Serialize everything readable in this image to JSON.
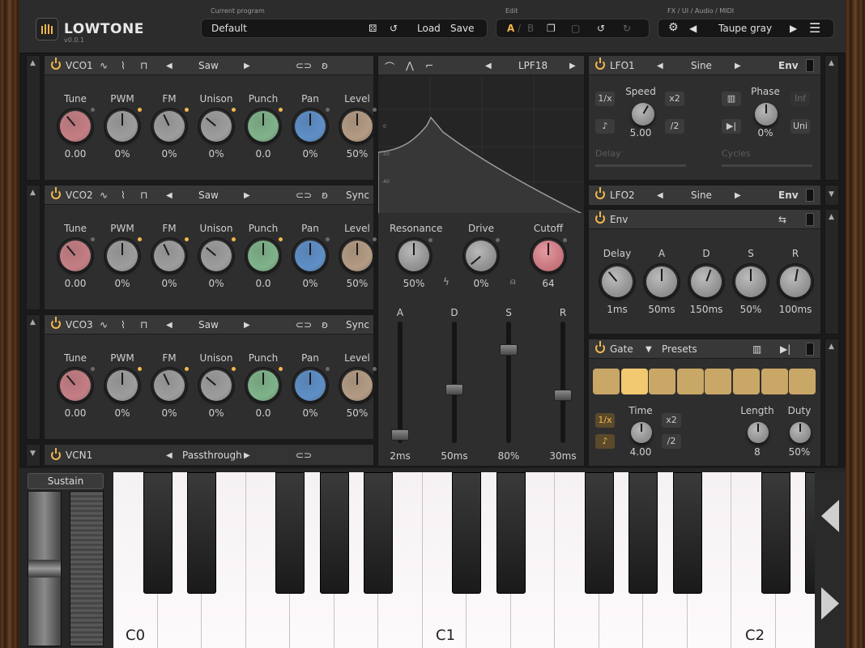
{
  "app": {
    "title": "LOWTONE",
    "version": "v0.0.1"
  },
  "topbar": {
    "program_label": "Current program",
    "program_name": "Default",
    "load": "Load",
    "save": "Save",
    "edit_label": "Edit",
    "edit_a": "A",
    "edit_sep": "/",
    "edit_b": "B",
    "fx_label": "FX / UI / Audio / MIDI",
    "theme": "Taupe gray"
  },
  "vco_common": {
    "labels": [
      "Tune",
      "PWM",
      "FM",
      "Unison",
      "Punch",
      "Pan",
      "Level"
    ],
    "colors": [
      "#c47e84",
      "#9d9d9d",
      "#9d9d9d",
      "#9d9d9d",
      "#7fb38a",
      "#5e8fc7",
      "#b39b84"
    ]
  },
  "vco1": {
    "name": "VCO1",
    "wave": "Saw",
    "sync": "",
    "values": [
      "0.00",
      "0%",
      "0%",
      "0%",
      "0.0",
      "0%",
      "50%"
    ]
  },
  "vco2": {
    "name": "VCO2",
    "wave": "Saw",
    "sync": "Sync",
    "values": [
      "0.00",
      "0%",
      "0%",
      "0%",
      "0.0",
      "0%",
      "50%"
    ]
  },
  "vco3": {
    "name": "VCO3",
    "wave": "Saw",
    "sync": "Sync",
    "values": [
      "0.00",
      "0%",
      "0%",
      "0%",
      "0.0",
      "0%",
      "50%"
    ]
  },
  "vcn1": {
    "name": "VCN1",
    "mode": "Passthrough"
  },
  "filter": {
    "type": "LPF18",
    "db_labels": [
      "0",
      "-20",
      "-40"
    ],
    "resonance": {
      "label": "Resonance",
      "value": "50%"
    },
    "drive": {
      "label": "Drive",
      "value": "0%"
    },
    "cutoff": {
      "label": "Cutoff",
      "value": "64"
    },
    "env": {
      "labels": [
        "A",
        "D",
        "S",
        "R"
      ],
      "values": [
        "2ms",
        "50ms",
        "80%",
        "30ms"
      ],
      "levels": [
        0.05,
        0.45,
        0.8,
        0.4
      ]
    }
  },
  "lfo1": {
    "name": "LFO1",
    "wave": "Sine",
    "env": "Env",
    "speed_label": "Speed",
    "speed": "5.00",
    "phase_label": "Phase",
    "phase": "0%",
    "inv": "Inf",
    "uni": "Uni",
    "frac": "1/x",
    "x2": "x2",
    "div2": "/2",
    "delay": "Delay",
    "cycles": "Cycles"
  },
  "lfo2": {
    "name": "LFO2",
    "wave": "Sine",
    "env": "Env"
  },
  "env": {
    "name": "Env",
    "labels": [
      "Delay",
      "A",
      "D",
      "S",
      "R"
    ],
    "values": [
      "1ms",
      "50ms",
      "150ms",
      "50%",
      "100ms"
    ]
  },
  "gate": {
    "name": "Gate",
    "presets": "Presets",
    "time_label": "Time",
    "time": "4.00",
    "length_label": "Length",
    "length": "8",
    "duty_label": "Duty",
    "duty": "50%",
    "frac": "1/x",
    "x2": "x2",
    "div2": "/2",
    "steps_on": [
      false,
      true,
      false,
      false,
      false,
      false,
      false,
      false
    ]
  },
  "keyboard": {
    "sustain": "Sustain",
    "labels": [
      "C0",
      "C1",
      "C2"
    ]
  }
}
